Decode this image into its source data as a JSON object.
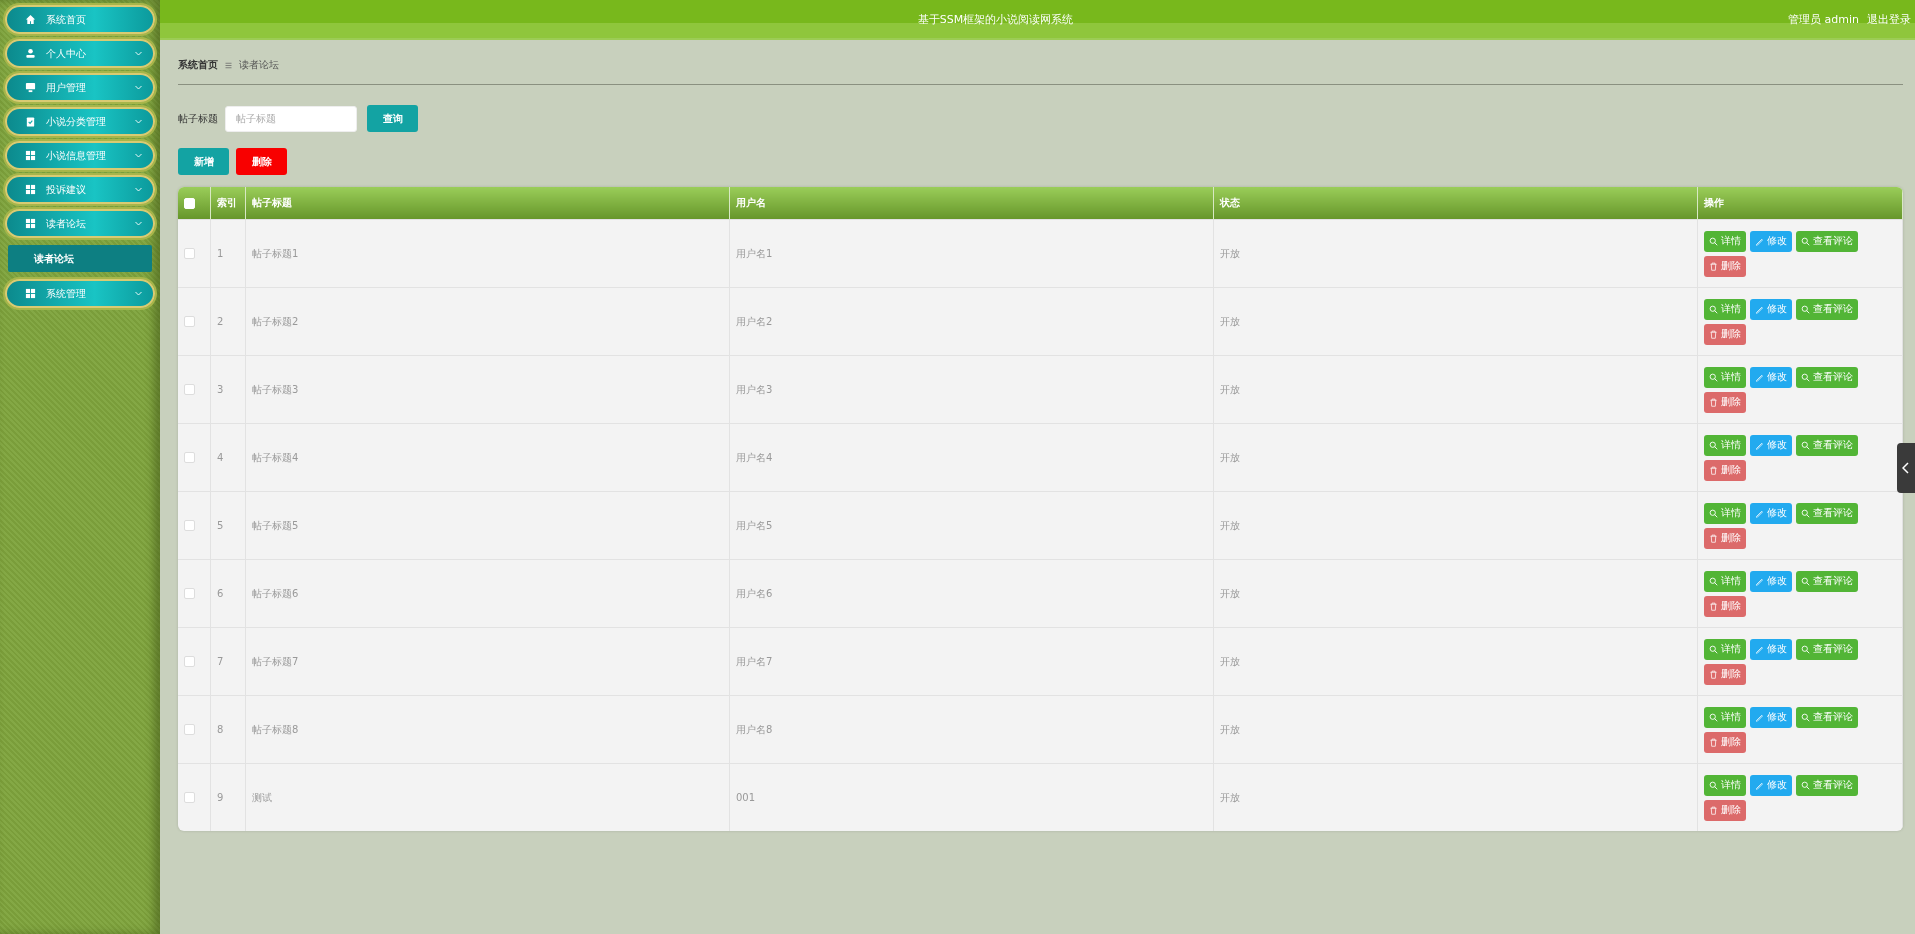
{
  "header": {
    "title": "基于SSM框架的小说阅读网系统",
    "user": "管理员 admin",
    "logout": "退出登录"
  },
  "sidebar": {
    "items": [
      {
        "label": "系统首页",
        "kind": "link"
      },
      {
        "label": "个人中心",
        "kind": "menu"
      },
      {
        "label": "用户管理",
        "kind": "menu"
      },
      {
        "label": "小说分类管理",
        "kind": "menu"
      },
      {
        "label": "小说信息管理",
        "kind": "menu"
      },
      {
        "label": "投诉建议",
        "kind": "menu"
      },
      {
        "label": "读者论坛",
        "kind": "menu",
        "children": [
          {
            "label": "读者论坛",
            "selected": true
          }
        ]
      },
      {
        "label": "系统管理",
        "kind": "menu"
      }
    ]
  },
  "breadcrumb": [
    "系统首页",
    "读者论坛"
  ],
  "search": {
    "label": "帖子标题",
    "placeholder": "帖子标题",
    "button": "查询"
  },
  "toolbar": [
    {
      "label": "新增",
      "kind": "add"
    },
    {
      "label": "删除",
      "kind": "delete"
    }
  ],
  "table": {
    "columns": [
      "索引",
      "帖子标题",
      "用户名",
      "状态",
      "操作"
    ],
    "all_checked": false,
    "rows": [
      {
        "checked": false,
        "index": "1",
        "title": "帖子标题1",
        "user": "用户名1",
        "status": "开放",
        "actions": [
          {
            "label": "详情",
            "kind": "view"
          },
          {
            "label": "修改",
            "kind": "edit"
          },
          {
            "label": "查看评论",
            "kind": "view"
          },
          {
            "label": "删除",
            "kind": "delete"
          }
        ]
      },
      {
        "checked": false,
        "index": "2",
        "title": "帖子标题2",
        "user": "用户名2",
        "status": "开放",
        "actions": [
          {
            "label": "详情",
            "kind": "view"
          },
          {
            "label": "修改",
            "kind": "edit"
          },
          {
            "label": "查看评论",
            "kind": "view"
          },
          {
            "label": "删除",
            "kind": "delete"
          }
        ]
      },
      {
        "checked": false,
        "index": "3",
        "title": "帖子标题3",
        "user": "用户名3",
        "status": "开放",
        "actions": [
          {
            "label": "详情",
            "kind": "view"
          },
          {
            "label": "修改",
            "kind": "edit"
          },
          {
            "label": "查看评论",
            "kind": "view"
          },
          {
            "label": "删除",
            "kind": "delete"
          }
        ]
      },
      {
        "checked": false,
        "index": "4",
        "title": "帖子标题4",
        "user": "用户名4",
        "status": "开放",
        "actions": [
          {
            "label": "详情",
            "kind": "view"
          },
          {
            "label": "修改",
            "kind": "edit"
          },
          {
            "label": "查看评论",
            "kind": "view"
          },
          {
            "label": "删除",
            "kind": "delete"
          }
        ]
      },
      {
        "checked": false,
        "index": "5",
        "title": "帖子标题5",
        "user": "用户名5",
        "status": "开放",
        "actions": [
          {
            "label": "详情",
            "kind": "view"
          },
          {
            "label": "修改",
            "kind": "edit"
          },
          {
            "label": "查看评论",
            "kind": "view"
          },
          {
            "label": "删除",
            "kind": "delete"
          }
        ]
      },
      {
        "checked": false,
        "index": "6",
        "title": "帖子标题6",
        "user": "用户名6",
        "status": "开放",
        "actions": [
          {
            "label": "详情",
            "kind": "view"
          },
          {
            "label": "修改",
            "kind": "edit"
          },
          {
            "label": "查看评论",
            "kind": "view"
          },
          {
            "label": "删除",
            "kind": "delete"
          }
        ]
      },
      {
        "checked": false,
        "index": "7",
        "title": "帖子标题7",
        "user": "用户名7",
        "status": "开放",
        "actions": [
          {
            "label": "详情",
            "kind": "view"
          },
          {
            "label": "修改",
            "kind": "edit"
          },
          {
            "label": "查看评论",
            "kind": "view"
          },
          {
            "label": "删除",
            "kind": "delete"
          }
        ]
      },
      {
        "checked": false,
        "index": "8",
        "title": "帖子标题8",
        "user": "用户名8",
        "status": "开放",
        "actions": [
          {
            "label": "详情",
            "kind": "view"
          },
          {
            "label": "修改",
            "kind": "edit"
          },
          {
            "label": "查看评论",
            "kind": "view"
          },
          {
            "label": "删除",
            "kind": "delete"
          }
        ]
      },
      {
        "checked": false,
        "index": "9",
        "title": "测试",
        "user": "001",
        "status": "开放",
        "actions": [
          {
            "label": "详情",
            "kind": "view"
          },
          {
            "label": "修改",
            "kind": "edit"
          },
          {
            "label": "查看评论",
            "kind": "view"
          },
          {
            "label": "删除",
            "kind": "delete"
          }
        ]
      }
    ]
  }
}
